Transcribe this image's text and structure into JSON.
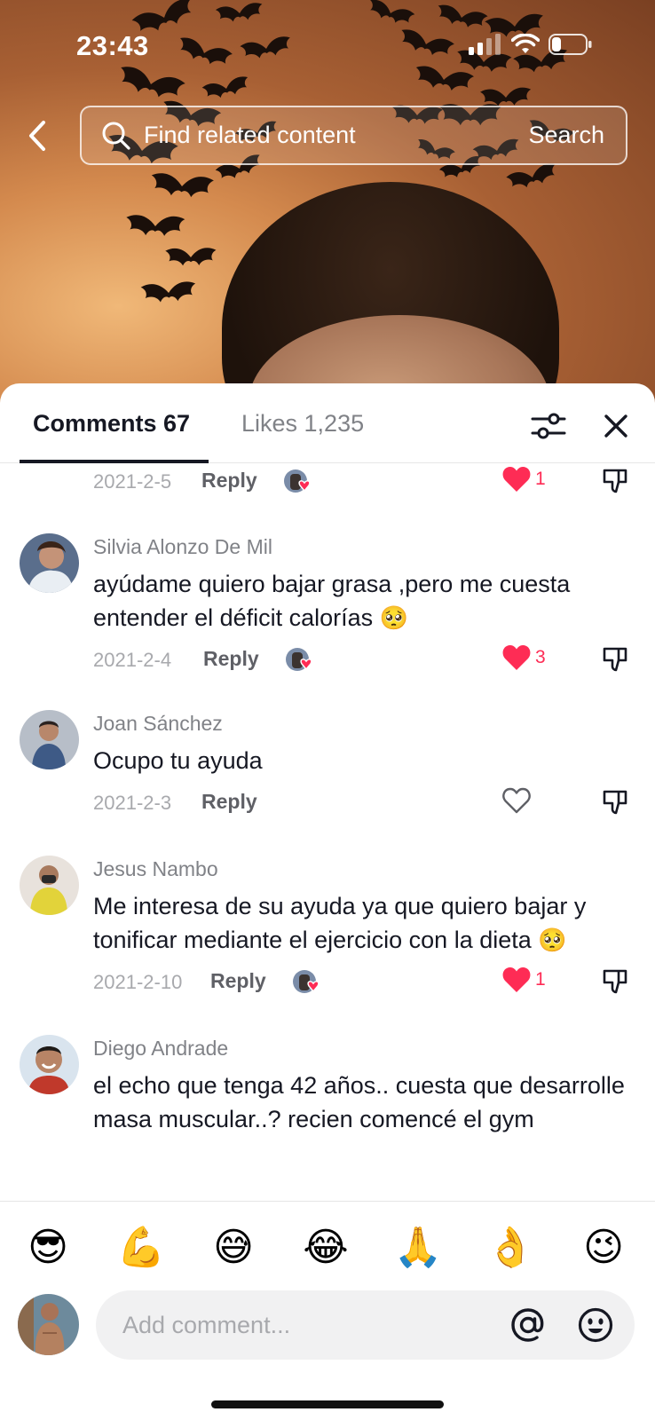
{
  "status_bar": {
    "time": "23:43"
  },
  "search": {
    "placeholder": "Find related content",
    "button_label": "Search"
  },
  "tabs": {
    "comments_label": "Comments 67",
    "likes_label": "Likes 1,235"
  },
  "comments": [
    {
      "date": "2021-2-5",
      "reply_label": "Reply",
      "creator_liked": true,
      "liked": true,
      "like_count": "1"
    },
    {
      "username": "Silvia Alonzo De Mil",
      "text": "ayúdame quiero bajar grasa ,pero me cuesta entender el déficit calorías",
      "emoji": "🥺",
      "date": "2021-2-4",
      "reply_label": "Reply",
      "creator_liked": true,
      "liked": true,
      "like_count": "3"
    },
    {
      "username": "Joan Sánchez",
      "text": "Ocupo tu ayuda",
      "date": "2021-2-3",
      "reply_label": "Reply",
      "creator_liked": false,
      "liked": false,
      "like_count": ""
    },
    {
      "username": "Jesus Nambo",
      "text": "Me interesa de su ayuda ya que quiero bajar y tonificar mediante el ejercicio con la dieta",
      "emoji": "🥺",
      "date": "2021-2-10",
      "reply_label": "Reply",
      "creator_liked": true,
      "liked": true,
      "like_count": "1"
    },
    {
      "username": "Diego Andrade",
      "text": "el echo que tenga 42 años.. cuesta que desarrolle masa muscular..? recien comencé el gym"
    }
  ],
  "quick_emojis": [
    "😎",
    "💪",
    "😅",
    "😂",
    "🙏",
    "👌",
    "😉"
  ],
  "composer": {
    "placeholder": "Add comment..."
  },
  "colors": {
    "like_red": "#fe2c55",
    "text_primary": "#161823",
    "text_secondary": "#808287"
  },
  "icons": [
    "back-arrow-icon",
    "search-icon",
    "filter-icon",
    "close-icon",
    "heart-icon",
    "dislike-icon",
    "mention-icon",
    "emoji-icon"
  ]
}
